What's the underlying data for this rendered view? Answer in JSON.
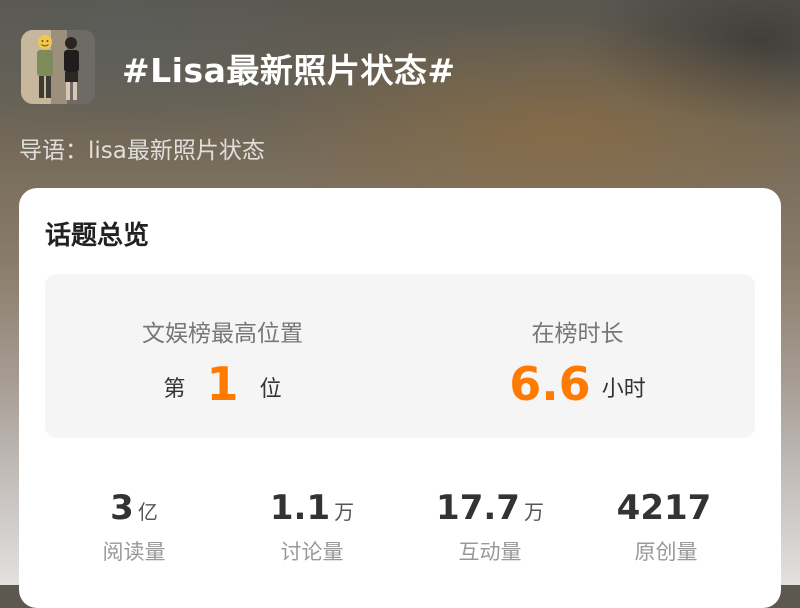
{
  "header": {
    "topic_title": "#Lisa最新照片状态#",
    "guide_text": "导语：lisa最新照片状态"
  },
  "overview": {
    "title": "话题总览",
    "highest_rank": {
      "label": "文娱榜最高位置",
      "prefix": "第",
      "value": "1",
      "suffix": "位"
    },
    "duration": {
      "label": "在榜时长",
      "value": "6.6",
      "unit": "小时"
    },
    "stats": [
      {
        "value": "3",
        "unit": "亿",
        "label": "阅读量"
      },
      {
        "value": "1.1",
        "unit": "万",
        "label": "讨论量"
      },
      {
        "value": "17.7",
        "unit": "万",
        "label": "互动量"
      },
      {
        "value": "4217",
        "unit": "",
        "label": "原创量"
      }
    ]
  },
  "colors": {
    "accent": "#ff7a00",
    "card_bg": "#ffffff",
    "rank_box_bg": "#f5f5f5"
  }
}
